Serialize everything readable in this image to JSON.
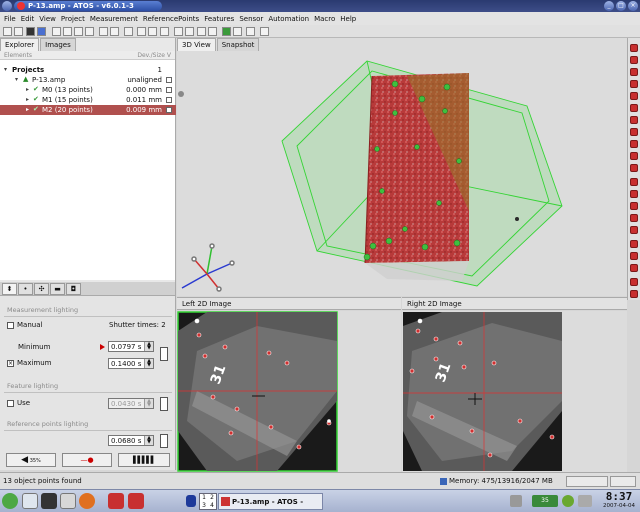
{
  "window": {
    "title": "P-13.amp - ATOS - v6.0.1-3"
  },
  "menu": [
    "File",
    "Edit",
    "View",
    "Project",
    "Measurement",
    "ReferencePoints",
    "Features",
    "Sensor",
    "Automation",
    "Macro",
    "Help"
  ],
  "explorer": {
    "tabs": [
      "Explorer",
      "Images"
    ],
    "columns": {
      "left": "Elements",
      "right": "Dev./Size  V"
    },
    "projects_label": "Projects",
    "projects_count": "1",
    "project": {
      "name": "P-13.amp",
      "status": "unaligned"
    },
    "measurements": [
      {
        "name": "M0  (13 points)",
        "dev": "0.000 mm",
        "selected": false
      },
      {
        "name": "M1  (15 points)",
        "dev": "0.011 mm",
        "selected": false
      },
      {
        "name": "M2  (20 points)",
        "dev": "0.009 mm",
        "selected": true
      }
    ]
  },
  "view3d": {
    "tabs": [
      "3D View",
      "Snapshot"
    ]
  },
  "lighting": {
    "measurement_lighting": "Measurement lighting",
    "manual_label": "Manual",
    "shutter_times": "Shutter times: 2",
    "minimum_label": "Minimum",
    "minimum_value": "0.0797 s",
    "maximum_label": "Maximum",
    "maximum_value": "0.1400 s",
    "feature_lighting": "Feature lighting",
    "use_label": "Use",
    "use_value": "0.0430 s",
    "reference_lighting": "Reference points lighting",
    "reference_value": "0.0680 s",
    "brightness": "35%"
  },
  "images": {
    "left_title": "Left 2D Image",
    "right_title": "Right 2D Image"
  },
  "status": {
    "text": "13 object points found",
    "memory": "Memory: 475/13916/2047 MB"
  },
  "taskbar": {
    "task_title": "P-13.amp - ATOS - v6.0.1",
    "pager": [
      "1",
      "2",
      "3",
      "4"
    ],
    "tray_text": "35",
    "clock": "8:37",
    "date": "2007-04-04"
  },
  "colors": {
    "selection": "#b0504e",
    "bbox_green": "#35d435",
    "crosshair": "#e03030",
    "titlebar": "#2a3a70"
  }
}
